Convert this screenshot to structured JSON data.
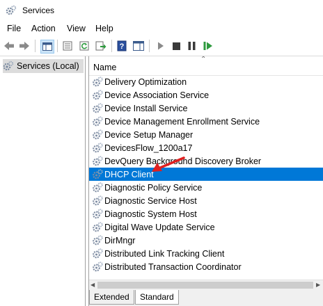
{
  "window": {
    "title": "Services",
    "icon": "gear-icon"
  },
  "menu": {
    "items": [
      "File",
      "Action",
      "View",
      "Help"
    ]
  },
  "toolbar": {
    "buttons": [
      "back-icon",
      "forward-icon",
      "show-tree-icon",
      "properties-icon",
      "refresh-icon",
      "export-list-icon",
      "help-icon",
      "show-hide-action-pane-icon",
      "start-service-icon",
      "stop-service-icon",
      "pause-service-icon",
      "restart-service-icon"
    ]
  },
  "tree": {
    "selected_label": "Services (Local)"
  },
  "list": {
    "column_header": "Name",
    "rows": [
      "Delivery Optimization",
      "Device Association Service",
      "Device Install Service",
      "Device Management Enrollment Service",
      "Device Setup Manager",
      "DevicesFlow_1200a17",
      "DevQuery Background Discovery Broker",
      "DHCP Client",
      "Diagnostic Policy Service",
      "Diagnostic Service Host",
      "Diagnostic System Host",
      "Digital Wave Update Service",
      "DirMngr",
      "Distributed Link Tracking Client",
      "Distributed Transaction Coordinator"
    ],
    "selected_row": "DHCP Client"
  },
  "tabs": {
    "extended": "Extended",
    "standard": "Standard",
    "active": "Standard"
  },
  "colors": {
    "selection": "#0078d7",
    "arrow": "#e02020"
  }
}
